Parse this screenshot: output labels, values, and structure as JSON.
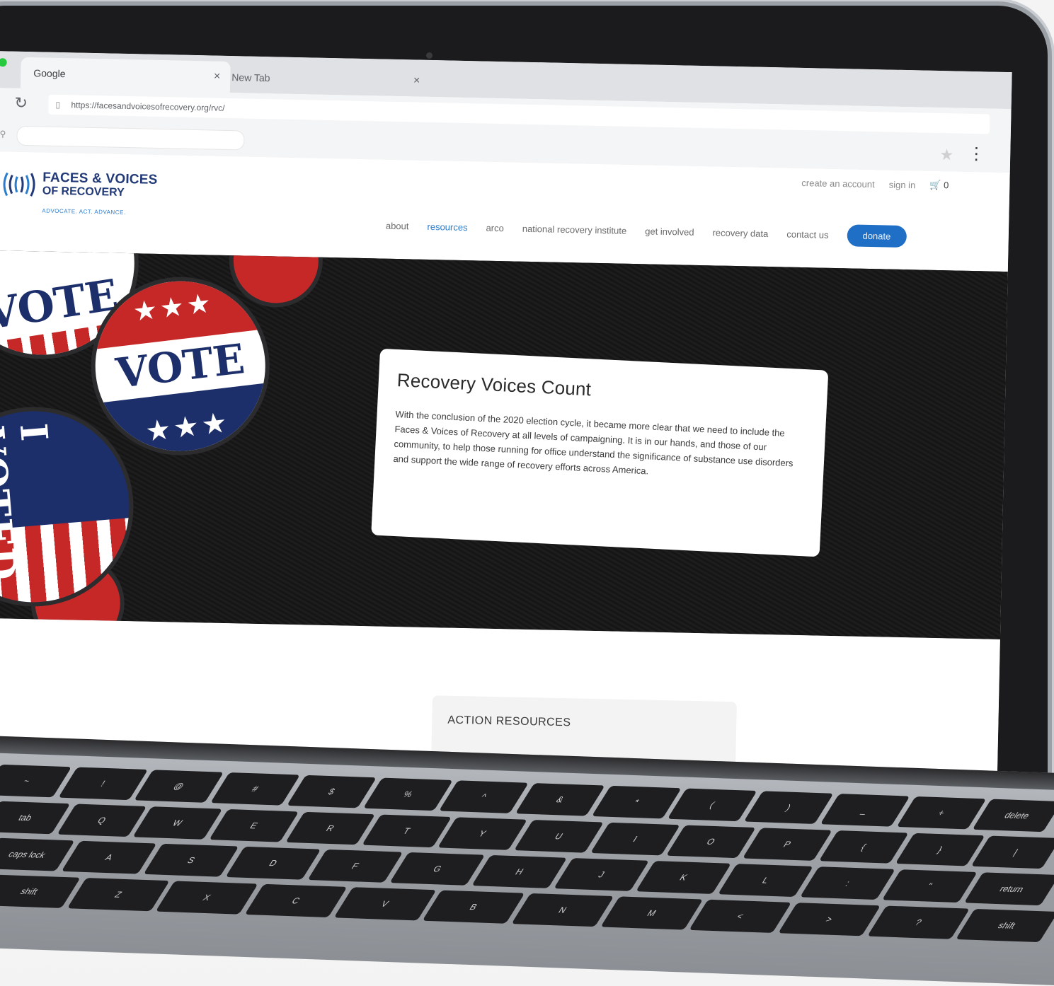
{
  "browser": {
    "tabs": [
      {
        "label": "Google",
        "close": "×"
      },
      {
        "label": "New Tab",
        "close": "×"
      }
    ],
    "url": "https://facesandvoicesofrecovery.org/rvc/",
    "search_placeholder": ""
  },
  "site": {
    "logo": {
      "line1": "FACES & VOICES",
      "line2": "OF RECOVERY",
      "tagline": "ADVOCATE. ACT. ADVANCE."
    },
    "utility": {
      "create_account": "create an account",
      "sign_in": "sign in",
      "cart_count": "0"
    },
    "nav": [
      {
        "label": "about",
        "active": false
      },
      {
        "label": "resources",
        "active": true
      },
      {
        "label": "arco",
        "active": false
      },
      {
        "label": "national recovery institute",
        "active": false
      },
      {
        "label": "get involved",
        "active": false
      },
      {
        "label": "recovery data",
        "active": false
      },
      {
        "label": "contact us",
        "active": false
      }
    ],
    "donate_label": "donate",
    "brand_color": "#233a78",
    "accent_color": "#1f6fc6"
  },
  "hero": {
    "badges": {
      "vote_top": "VOTE",
      "vote_main": "VOTE",
      "voted": "I VOTED"
    },
    "card": {
      "title": "Recovery Voices Count",
      "body": "With the conclusion of the 2020 election cycle, it became more clear that we need to include the Faces & Voices of Recovery at all levels of campaigning. It is in our hands, and those of our community, to help those running for office understand the significance of substance use disorders and support the wide range of recovery efforts across America."
    }
  },
  "content": {
    "action_title": "ACTION RESOURCES"
  },
  "keyboard": {
    "rows": [
      [
        "~",
        "!",
        "@",
        "#",
        "$",
        "%",
        "^",
        "&",
        "*",
        "(",
        ")",
        "_",
        "+",
        "delete"
      ],
      [
        "tab",
        "Q",
        "W",
        "E",
        "R",
        "T",
        "Y",
        "U",
        "I",
        "O",
        "P",
        "{",
        "}",
        "|"
      ],
      [
        "caps lock",
        "A",
        "S",
        "D",
        "F",
        "G",
        "H",
        "J",
        "K",
        "L",
        ":",
        "\"",
        "return"
      ],
      [
        "shift",
        "Z",
        "X",
        "C",
        "V",
        "B",
        "N",
        "M",
        "<",
        ">",
        "?",
        "shift"
      ]
    ]
  }
}
